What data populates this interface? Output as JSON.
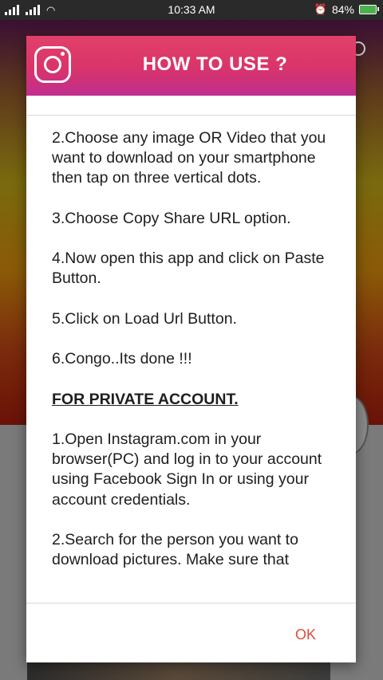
{
  "status_bar": {
    "time": "10:33 AM",
    "battery": "84%"
  },
  "dialog": {
    "title": "HOW TO USE ?",
    "instructions": [
      "2.Choose any image OR Video that you want to download on your smartphone then tap on three vertical dots.",
      "3.Choose Copy Share URL option.",
      "4.Now open this app and click on Paste Button.",
      "5.Click on Load Url Button.",
      "6.Congo..Its done !!!"
    ],
    "private_heading": "FOR PRIVATE ACCOUNT.",
    "private_steps": [
      "1.Open Instagram.com in your browser(PC) and log in to your account using Facebook Sign In or using your account credentials.",
      "2.Search for the person you want to download pictures. Make sure that"
    ],
    "ok_label": "OK"
  },
  "colors": {
    "header_gradient_start": "#e2406b",
    "header_gradient_end": "#c02e8f",
    "ok_button": "#e04a3a"
  }
}
